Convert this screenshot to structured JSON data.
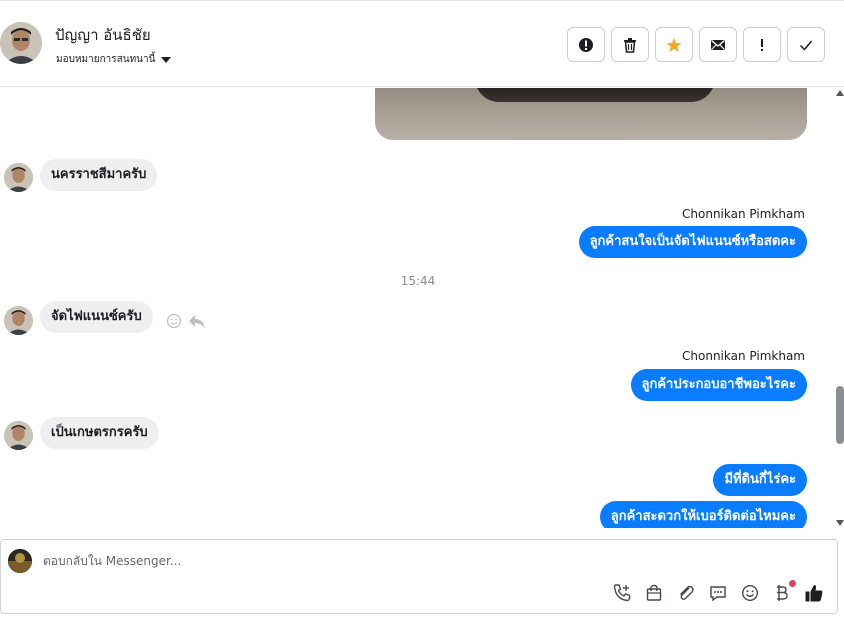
{
  "header": {
    "contact_name": "ปัญญา อันธิชัย",
    "assign_label": "มอบหมายการสนทนานี้",
    "actions": [
      {
        "icon": "alert-circle-icon"
      },
      {
        "icon": "trash-icon"
      },
      {
        "icon": "star-icon"
      },
      {
        "icon": "envelope-icon"
      },
      {
        "icon": "exclamation-icon"
      },
      {
        "icon": "check-icon"
      }
    ]
  },
  "messages": [
    {
      "direction": "in",
      "text": "นครราชสีมาครับ"
    },
    {
      "direction": "out",
      "sender": "Chonnikan Pimkham",
      "text": "ลูกค้าสนใจเป็นจัดไฟแนนซ์หรือสดคะ"
    },
    {
      "type": "timestamp",
      "text": "15:44"
    },
    {
      "direction": "in",
      "text": "จัดไฟแนนซ์ครับ"
    },
    {
      "direction": "out",
      "sender": "Chonnikan Pimkham",
      "text": "ลูกค้าประกอบอาชีพอะไรคะ"
    },
    {
      "direction": "in",
      "text": "เป็นเกษตรกรครับ"
    },
    {
      "direction": "out",
      "text": "มีที่ดินกี่ไร่คะ"
    },
    {
      "direction": "out",
      "text": "ลูกค้าสะดวกให้เบอร์ติดต่อไหมคะ"
    }
  ],
  "composer": {
    "placeholder": "ตอบกลับใน Messenger...",
    "tools": [
      "phone-plus-icon",
      "shopping-bag-icon",
      "paperclip-icon",
      "chat-bubble-icon",
      "smiley-icon",
      "baht-icon",
      "thumbs-up-icon"
    ]
  },
  "colors": {
    "outgoing_bubble": "#0a7cff",
    "incoming_bubble": "#eeeff1",
    "star": "#f5a623",
    "notification_dot": "#e4405f"
  }
}
